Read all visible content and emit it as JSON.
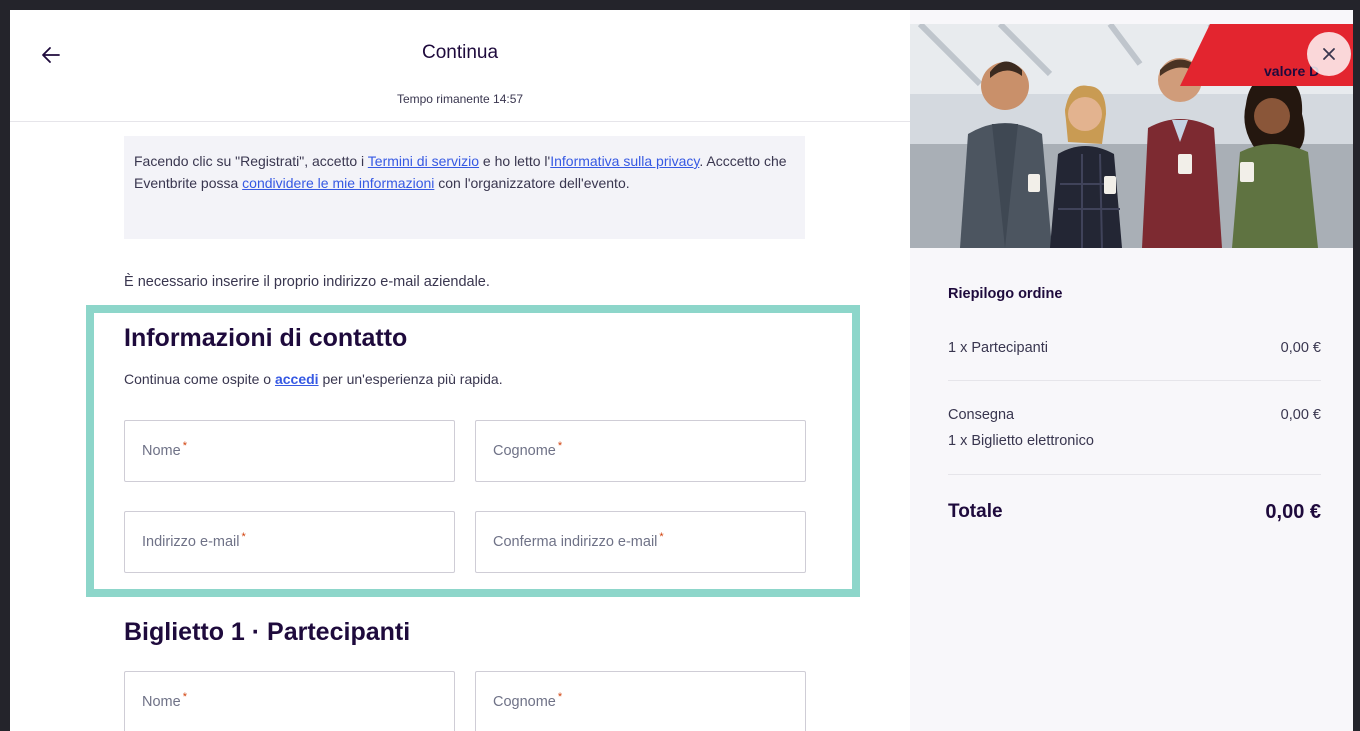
{
  "header": {
    "title": "Continua",
    "timer_label": "Tempo rimanente",
    "timer_value": "14:57"
  },
  "notice": {
    "part1": "Facendo clic su \"Registrati\", accetto i ",
    "terms_link": "Termini di servizio",
    "part2": " e ho letto l'",
    "privacy_link": "Informativa sulla privacy",
    "part3": ". Acccetto che Eventbrite possa ",
    "share_link": "condividere le mie informazioni",
    "part4": " con l'organizzatore dell'evento."
  },
  "corporate_note": "È necessario inserire il proprio indirizzo e-mail aziendale.",
  "contact": {
    "title": "Informazioni di contatto",
    "sub_before": "Continua come ospite o ",
    "sub_link": "accedi",
    "sub_after": " per un'esperienza più rapida.",
    "fields": {
      "first_name": "Nome",
      "last_name": "Cognome",
      "email": "Indirizzo e-mail",
      "confirm_email": "Conferma indirizzo e-mail"
    }
  },
  "ticket": {
    "title": "Biglietto 1 · Partecipanti",
    "fields": {
      "first_name": "Nome",
      "last_name": "Cognome"
    }
  },
  "required_mark": "*",
  "hero": {
    "logo_text": "valore D"
  },
  "summary": {
    "title": "Riepilogo ordine",
    "line1_label": "1 x Partecipanti",
    "line1_value": "0,00 €",
    "delivery_label": "Consegna",
    "delivery_value": "0,00 €",
    "delivery_detail": "1 x Biglietto elettronico",
    "total_label": "Totale",
    "total_value": "0,00 €"
  },
  "colors": {
    "highlight_border": "#8dd6ca",
    "link": "#3659e3",
    "required": "#d1410c",
    "logo_red": "#e3252f"
  },
  "icons": {
    "back": "arrow-left-icon",
    "close": "close-icon"
  }
}
